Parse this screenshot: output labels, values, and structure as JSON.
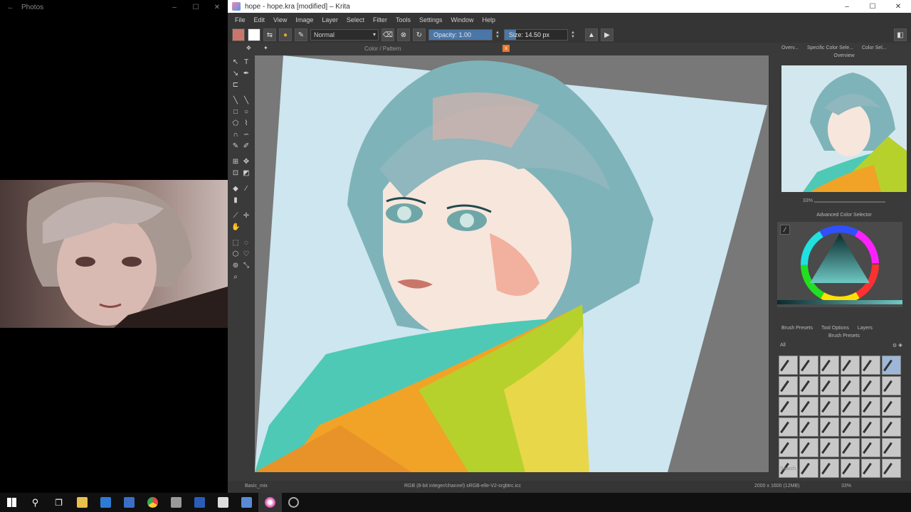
{
  "photos": {
    "title": "Photos",
    "back_glyph": "←",
    "window_controls": [
      "–",
      "☐",
      "✕"
    ]
  },
  "krita": {
    "title": "hope - hope.kra [modified] – Krita",
    "window_controls": [
      "–",
      "☐",
      "✕"
    ],
    "menu": [
      "File",
      "Edit",
      "View",
      "Image",
      "Layer",
      "Select",
      "Filter",
      "Tools",
      "Settings",
      "Window",
      "Help"
    ],
    "toolbar": {
      "blend_mode": "Normal",
      "opacity_label": "Opacity: 1.00",
      "opacity_value": 1.0,
      "size_label": "Size: 14.50 px"
    },
    "document_tab": "Color / Pattern",
    "close_glyph": "x",
    "docker_tabs": [
      "Overv...",
      "Specific Color Sele...",
      "Color Sel..."
    ],
    "overview_title": "Overview",
    "overview_zoom": "33%",
    "color_dock_title": "Advanced Color Selector",
    "brush_tabs": [
      "Brush Presets",
      "Tool Options",
      "Layers"
    ],
    "brush_presets_title": "Brush Presets",
    "brush_filter_label": "All",
    "brush_search_placeholder": "Search...",
    "status": {
      "brush": "Basic_mix",
      "info": "RGB (8-bit integer/channel) sRGB-elle-V2-srgbtrc.icc",
      "size": "2000 x 1600 (12MB)",
      "zoom": "33%"
    }
  },
  "taskbar": {
    "icons": [
      "windows-start-icon",
      "search-icon",
      "task-view-icon",
      "file-explorer-icon",
      "outlook-icon",
      "app-icon",
      "chrome-icon",
      "app-icon-2",
      "word-icon",
      "photos-icon",
      "app-icon-3",
      "krita-icon",
      "obs-icon"
    ]
  },
  "colors": {
    "canvas_bg": "#cde6ef",
    "accent_blue": "#4a76a8",
    "krita_orange": "#e8772a"
  }
}
